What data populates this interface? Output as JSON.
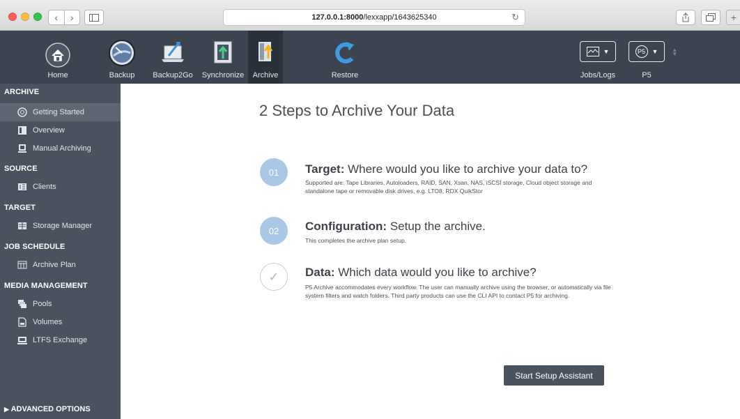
{
  "browser": {
    "url_host": "127.0.0.1:8000",
    "url_path": "/lexxapp/1643625340"
  },
  "toolbar": {
    "items": [
      {
        "label": "Home"
      },
      {
        "label": "Backup"
      },
      {
        "label": "Backup2Go"
      },
      {
        "label": "Synchronize"
      },
      {
        "label": "Archive"
      },
      {
        "label": "Restore"
      }
    ],
    "jobs_label": "Jobs/Logs",
    "p5_label": "P5",
    "p5_badge": "P5"
  },
  "sidebar": {
    "sections": [
      {
        "title": "ARCHIVE",
        "items": [
          {
            "label": "Getting Started",
            "icon": "lifebuoy-icon"
          },
          {
            "label": "Overview",
            "icon": "overview-icon"
          },
          {
            "label": "Manual Archiving",
            "icon": "manual-archive-icon"
          }
        ]
      },
      {
        "title": "SOURCE",
        "items": [
          {
            "label": "Clients",
            "icon": "clients-icon"
          }
        ]
      },
      {
        "title": "TARGET",
        "items": [
          {
            "label": "Storage Manager",
            "icon": "storage-icon"
          }
        ]
      },
      {
        "title": "JOB SCHEDULE",
        "items": [
          {
            "label": "Archive Plan",
            "icon": "plan-icon"
          }
        ]
      },
      {
        "title": "MEDIA MANAGEMENT",
        "items": [
          {
            "label": "Pools",
            "icon": "pools-icon"
          },
          {
            "label": "Volumes",
            "icon": "volumes-icon"
          },
          {
            "label": "LTFS Exchange",
            "icon": "ltfs-icon"
          }
        ]
      }
    ],
    "advanced_label": "ADVANCED OPTIONS"
  },
  "main": {
    "title": "2 Steps to Archive Your Data",
    "steps": [
      {
        "num": "01",
        "head_bold": "Target:",
        "head_rest": " Where would you like to archive your data to?",
        "desc": "Supported are: Tape Libraries, Autoloaders, RAID, SAN, Xsan, NAS, iSCSI storage, Cloud object storage and standalone tape or removable disk drives, e.g. LTO8, RDX QuikStor"
      },
      {
        "num": "02",
        "head_bold": "Configuration:",
        "head_rest": " Setup the archive.",
        "desc": "This completes the archive plan setup."
      },
      {
        "num": "✓",
        "head_bold": "Data:",
        "head_rest": " Which data would you like to archive?",
        "desc": "P5 Archive accommodates every workflow. The user can manually archive using the browser, or automatically via file system filters and watch folders. Third party products can use the CLI API to contact P5 for archiving."
      }
    ],
    "setup_button": "Start Setup Assistant"
  }
}
